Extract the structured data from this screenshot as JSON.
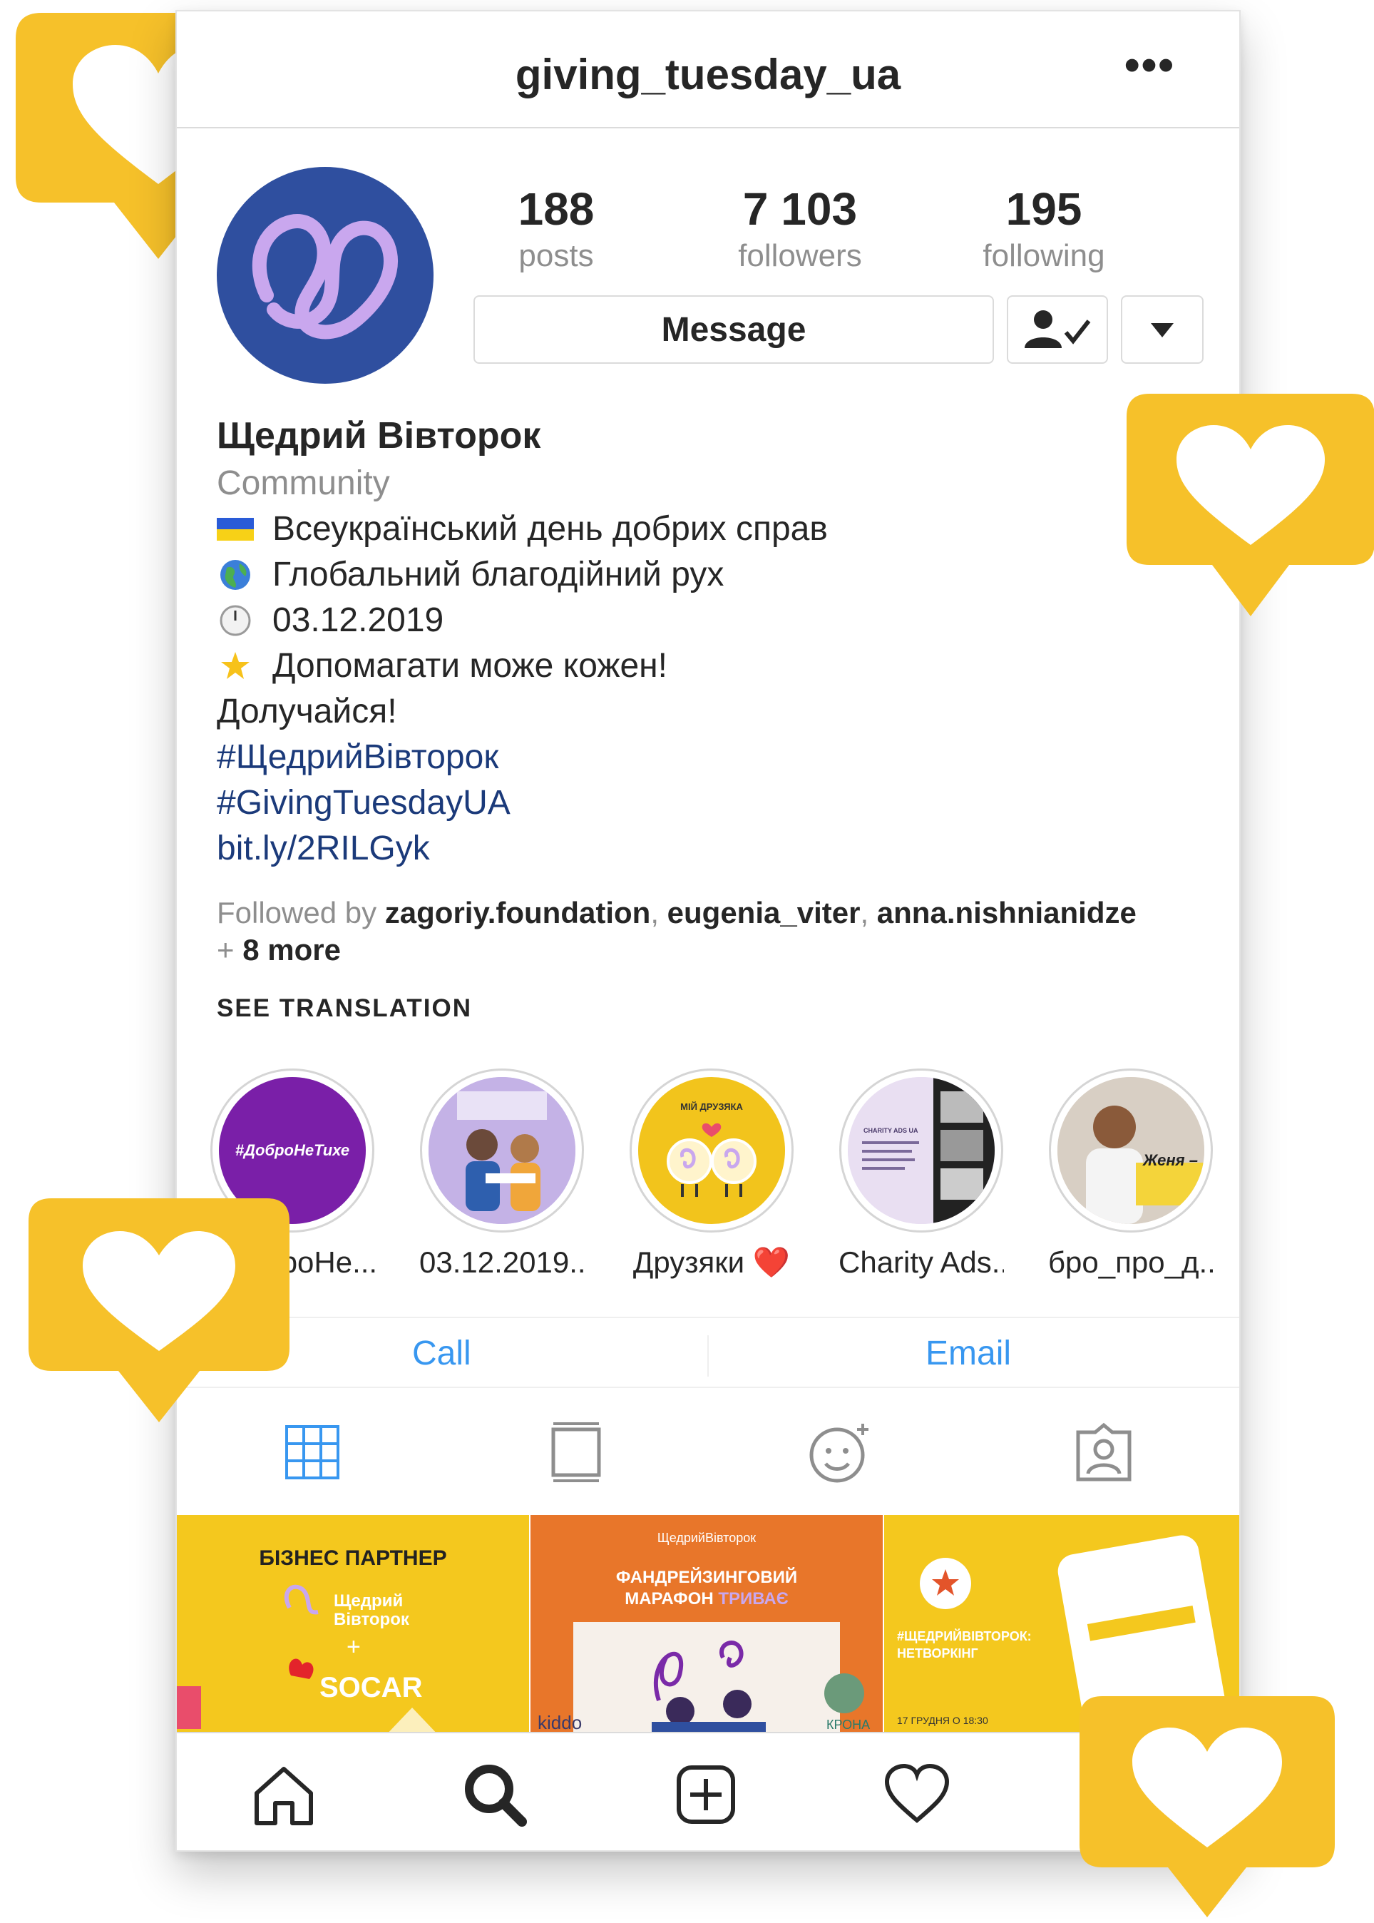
{
  "profile": {
    "username": "giving_tuesday_ua",
    "more_label": "•••",
    "stats": {
      "posts": {
        "value": "188",
        "label": "posts"
      },
      "followers": {
        "value": "7 103",
        "label": "followers"
      },
      "following": {
        "value": "195",
        "label": "following"
      }
    },
    "message_label": "Message",
    "name": "Щедрий Вівторок",
    "category": "Community",
    "bio_lines": [
      {
        "icon": "ukraine-flag-icon",
        "text": "Всеукраїнський день добрих справ"
      },
      {
        "icon": "globe-icon",
        "text": "Глобальний благодійний рух"
      },
      {
        "icon": "clock-icon",
        "text": "03.12.2019"
      },
      {
        "icon": "star-icon",
        "text": "Допомагати може кожен!"
      }
    ],
    "join": "Долучайся!",
    "hashtags": [
      "#ЩедрийВівторок",
      "#GivingTuesdayUA"
    ],
    "link": "bit.ly/2RILGyk",
    "followed_by_prefix": "Followed by",
    "followed_by": [
      "zagoriy.foundation",
      "eugenia_viter",
      "anna.nishnianidze"
    ],
    "followed_more": "8 more",
    "see_translation": "SEE TRANSLATION"
  },
  "highlights": [
    {
      "label": "#ДоброНе...",
      "inner_text": "#ДоброНеТихе",
      "color": "#7a1fa8"
    },
    {
      "label": "03.12.2019...",
      "inner_text": "",
      "color": "#c9b8e8"
    },
    {
      "label": "Друзяки ❤️",
      "inner_text": "МІЙ ДРУЗЯКА",
      "color": "#f2c41c"
    },
    {
      "label": "Charity Ads...",
      "inner_text": "CHARITY ADS UA",
      "color": "#d9c6ec"
    },
    {
      "label": "бро_про_д...",
      "inner_text": "Женя –",
      "color": "#f4d43a"
    }
  ],
  "contact": {
    "call": "Call",
    "email": "Email"
  },
  "posts": [
    {
      "title": "БІЗНЕС ПАРТНЕР",
      "brand": "Щедрий Вівторок",
      "plus": "+",
      "partner": "SOCAR",
      "bg": "#f4c81e"
    },
    {
      "top": "ЩедрийВівторок",
      "title": "ФАНДРЕЙЗИНГОВИЙ",
      "title2": "МАРАФОН",
      "title2b": "ТРИВАЄ",
      "partner1": "kiddo",
      "partner2": "КРОНА",
      "bg": "#e8762a"
    },
    {
      "title": "#ЩЕДРИЙВІВТОРОК:",
      "title2": "НЕТВОРКІНГ",
      "date": "17 ГРУДНЯ О 18:30",
      "bg": "#f4c81e"
    }
  ],
  "colors": {
    "accent": "#f6c12a",
    "link_blue": "#3897f0",
    "hashtag": "#1b3a7a",
    "avatar_bg": "#2f4f9f"
  }
}
